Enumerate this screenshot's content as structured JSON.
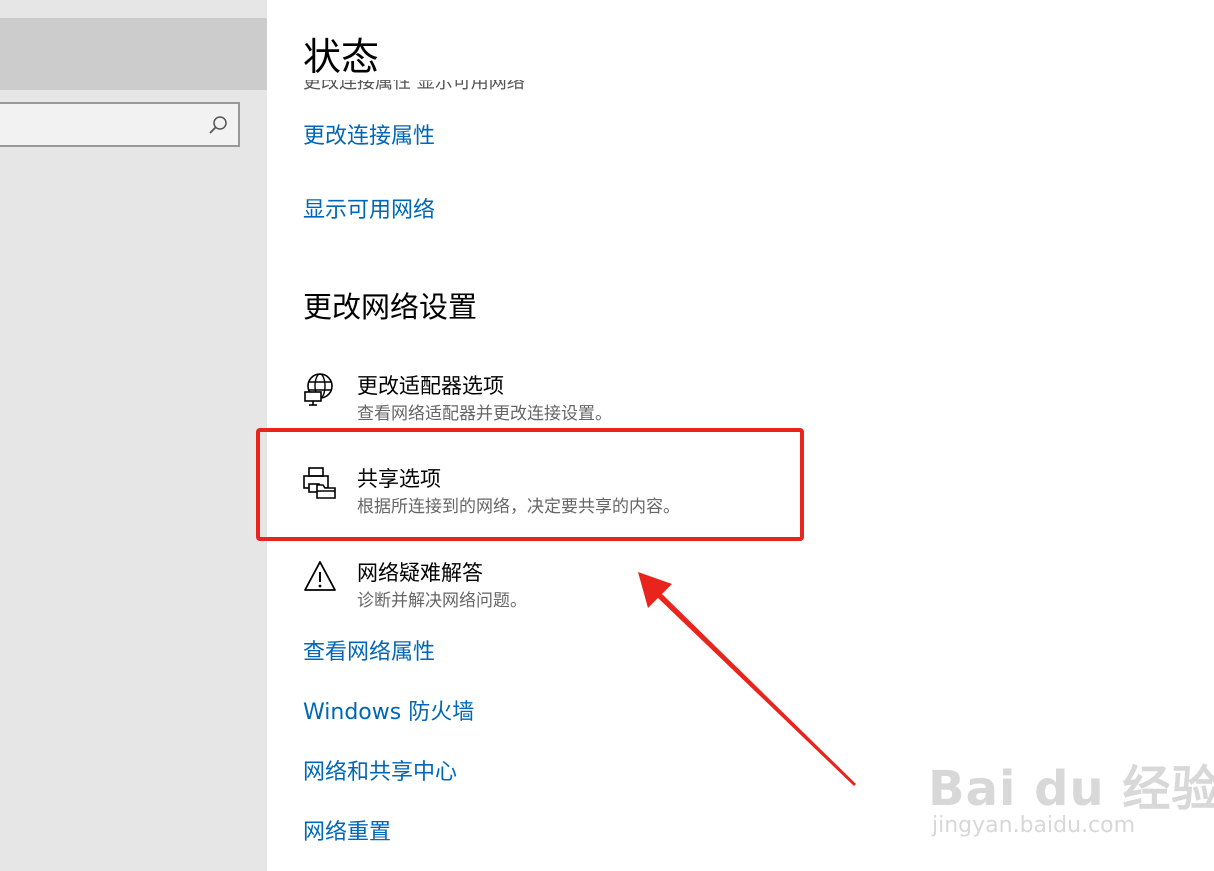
{
  "sidebar": {
    "search_placeholder": ""
  },
  "main": {
    "title": "状态",
    "clipped_text": "更改连接属性 显示可用网络",
    "links_top": [
      "更改连接属性",
      "显示可用网络"
    ],
    "section_title": "更改网络设置",
    "options": [
      {
        "title": "更改适配器选项",
        "description": "查看网络适配器并更改连接设置。",
        "icon": "network-adapter-icon"
      },
      {
        "title": "共享选项",
        "description": "根据所连接到的网络，决定要共享的内容。",
        "icon": "sharing-icon"
      },
      {
        "title": "网络疑难解答",
        "description": "诊断并解决网络问题。",
        "icon": "warning-icon"
      }
    ],
    "links_bottom": [
      "查看网络属性",
      "Windows 防火墙",
      "网络和共享中心",
      "网络重置"
    ]
  },
  "annotation": {
    "highlight_color": "#e8241c",
    "accent_color": "#0067b8"
  },
  "watermark": {
    "brand": "Bai du 经验",
    "url": "jingyan.baidu.com"
  }
}
